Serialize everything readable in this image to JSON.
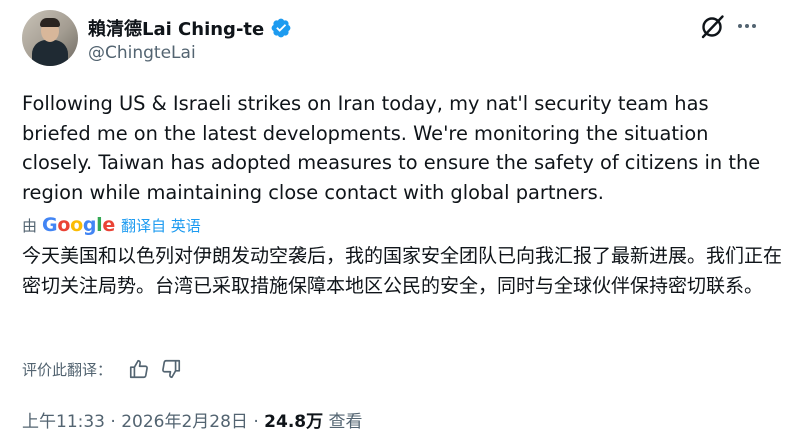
{
  "author": {
    "display_name": "賴清德Lai Ching-te",
    "handle": "@ChingteLai"
  },
  "tweet": {
    "text": "Following US & Israeli strikes on Iran today, my nat'l security team has briefed me on the latest developments. We're monitoring the situation closely. Taiwan has adopted measures to ensure the safety of citizens in the region while maintaining close contact with global partners."
  },
  "translation": {
    "by_prefix": "由",
    "provider": "Google",
    "action": "翻译自 英语",
    "text": "今天美国和以色列对伊朗发动空袭后，我的国家安全团队已向我汇报了最新进展。我们正在密切关注局势。台湾已采取措施保障本地区公民的安全，同时与全球伙伴保持密切联系。",
    "rate_label": "评价此翻译："
  },
  "meta": {
    "time": "上午11:33",
    "separator": "·",
    "date": "2026年2月28日",
    "views_count": "24.8万",
    "views_label": "查看"
  },
  "icons": {
    "verified": "verified-badge-icon",
    "grok": "grok-icon",
    "more": "more-options-icon",
    "thumbs_up": "thumbs-up-icon",
    "thumbs_down": "thumbs-down-icon"
  },
  "colors": {
    "text": "#0f1419",
    "secondary": "#536471",
    "link": "#1d9bf0",
    "verified": "#1d9bf0"
  }
}
